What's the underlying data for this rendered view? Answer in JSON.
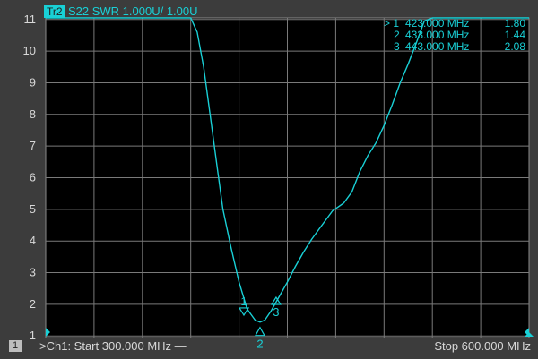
{
  "trace": {
    "id_label": "Tr2",
    "header": "S22 SWR 1.000U/ 1.00U",
    "color": "#19d0d6"
  },
  "markers": [
    {
      "num_label": "1",
      "row_label": "> 1",
      "freq": "423.000 MHz",
      "value": "1.80"
    },
    {
      "num_label": "2",
      "row_label": "2",
      "freq": "433.000 MHz",
      "value": "1.44"
    },
    {
      "num_label": "3",
      "row_label": "3",
      "freq": "443.000 MHz",
      "value": "2.08"
    }
  ],
  "footer": {
    "channel_box": "1",
    "start": ">Ch1: Start 300.000 MHz —",
    "stop": "Stop 600.000 MHz"
  },
  "chart_data": {
    "type": "line",
    "xlim": [
      300,
      600
    ],
    "ylim": [
      1,
      11
    ],
    "y_tick_labels": [
      "1",
      "2",
      "3",
      "4",
      "5",
      "6",
      "7",
      "8",
      "9",
      "10",
      "11"
    ],
    "grid": true,
    "series": [
      {
        "x": [
          300,
          390,
          394,
          398,
          402,
          406,
          410,
          415,
          420,
          425,
          430,
          433,
          436,
          440,
          445,
          450,
          455,
          460,
          465,
          470,
          478,
          485,
          490,
          495,
          500,
          505,
          510,
          515,
          520,
          525,
          530,
          535,
          540,
          545,
          550,
          556,
          560,
          565,
          570,
          575,
          580,
          590,
          600
        ],
        "y": [
          11.05,
          11.05,
          10.6,
          9.5,
          8.0,
          6.5,
          5.0,
          3.8,
          2.7,
          1.85,
          1.5,
          1.44,
          1.5,
          1.8,
          2.25,
          2.7,
          3.2,
          3.65,
          4.05,
          4.4,
          4.95,
          5.2,
          5.55,
          6.2,
          6.7,
          7.1,
          7.65,
          8.3,
          9.0,
          9.6,
          10.25,
          10.95,
          11.05,
          11.05,
          11.05,
          11.05,
          11.05,
          11.05,
          11.05,
          11.05,
          11.05,
          11.05,
          11.05
        ]
      }
    ],
    "markers": [
      {
        "x": 423,
        "y": 1.8
      },
      {
        "x": 433,
        "y": 1.44
      },
      {
        "x": 443,
        "y": 2.08
      }
    ]
  }
}
